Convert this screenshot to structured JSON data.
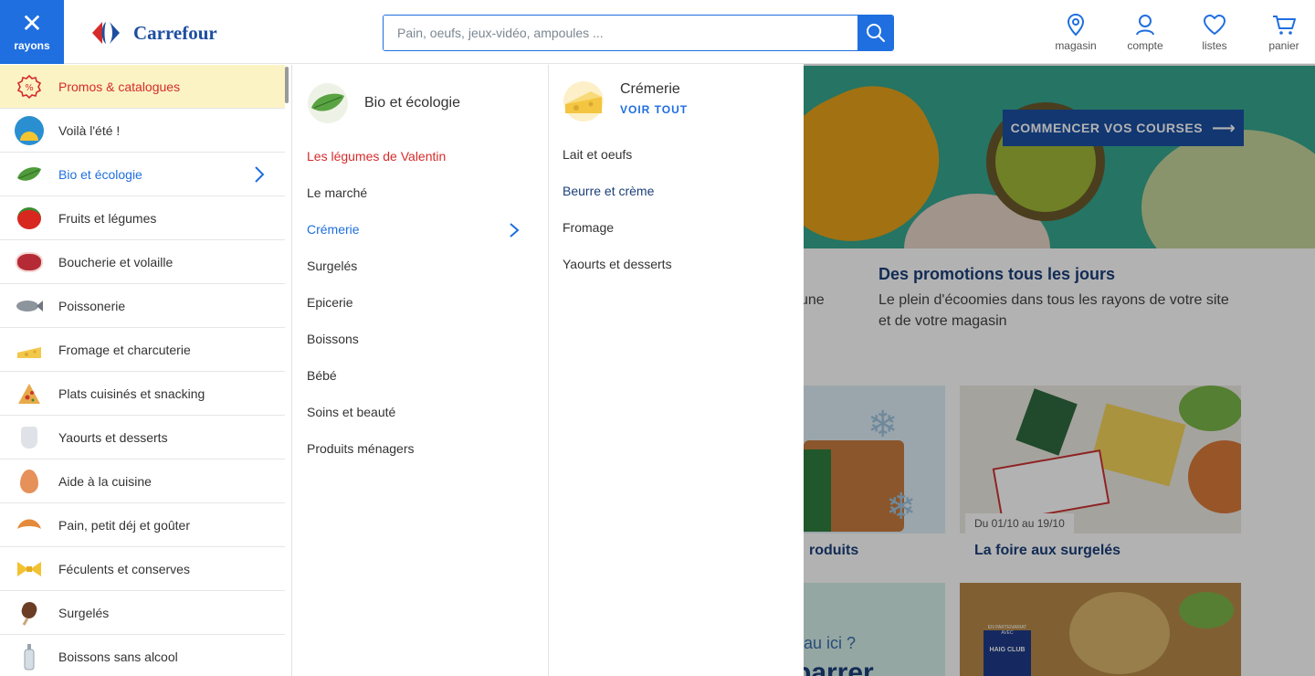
{
  "header": {
    "rayons_label": "rayons",
    "logo_text": "Carrefour",
    "search_placeholder": "Pain, oeufs, jeux-vidéo, ampoules ...",
    "icons": [
      {
        "label": "magasin",
        "icon": "location-pin-icon"
      },
      {
        "label": "compte",
        "icon": "user-icon"
      },
      {
        "label": "listes",
        "icon": "heart-icon"
      },
      {
        "label": "panier",
        "icon": "cart-icon"
      }
    ]
  },
  "colors": {
    "accent": "#1f6fe0",
    "promo_text": "#d62b2b",
    "promo_bg": "#fbf3c4",
    "navy": "#1a3f7a"
  },
  "menu_level1": [
    {
      "label": "Promos & catalogues",
      "icon": "percent-badge-icon"
    },
    {
      "label": "Voilà l'été !",
      "icon": "summer-icon"
    },
    {
      "label": "Bio et écologie",
      "icon": "leaf-icon"
    },
    {
      "label": "Fruits et légumes",
      "icon": "tomato-icon"
    },
    {
      "label": "Boucherie et volaille",
      "icon": "meat-icon"
    },
    {
      "label": "Poissonerie",
      "icon": "fish-icon"
    },
    {
      "label": "Fromage et charcuterie",
      "icon": "cheese-icon"
    },
    {
      "label": "Plats cuisinés et snacking",
      "icon": "pizza-icon"
    },
    {
      "label": "Yaourts et desserts",
      "icon": "yogurt-icon"
    },
    {
      "label": "Aide à la cuisine",
      "icon": "egg-icon"
    },
    {
      "label": "Pain, petit déj et goûter",
      "icon": "croissant-icon"
    },
    {
      "label": "Féculents et conserves",
      "icon": "pasta-icon"
    },
    {
      "label": "Surgelés",
      "icon": "ice-cream-icon"
    },
    {
      "label": "Boissons sans alcool",
      "icon": "bottle-icon"
    }
  ],
  "menu_level2": {
    "title": "Bio et écologie",
    "items": [
      {
        "label": "Les légumes de Valentin"
      },
      {
        "label": "Le marché"
      },
      {
        "label": "Crémerie"
      },
      {
        "label": "Surgelés"
      },
      {
        "label": "Epicerie"
      },
      {
        "label": "Boissons"
      },
      {
        "label": "Bébé"
      },
      {
        "label": "Soins et beauté"
      },
      {
        "label": "Produits ménagers"
      }
    ]
  },
  "menu_level3": {
    "title": "Crémerie",
    "see_all": "VOIR TOUT",
    "items": [
      {
        "label": "Lait et oeufs"
      },
      {
        "label": "Beurre et crème"
      },
      {
        "label": "Fromage"
      },
      {
        "label": "Yaourts et desserts"
      }
    ]
  },
  "background": {
    "cta_label": "COMMENCER VOS COURSES",
    "promo_title": "Des promotions tous les jours",
    "promo_text": "Le plein d'écoomies dans tous les rayons de votre site et de votre magasin",
    "partial_left_text": "une",
    "tile1_caption": "roduits",
    "tile2_date": "Du 01/10 au 19/10",
    "tile2_caption": "La foire aux surgelés",
    "tile3_text_a": "eau ici ?",
    "tile3_text_b": "parrer",
    "tile4_badge_top": "EN PARTENARIAT AVEC",
    "tile4_badge_brand": "HAIG CLUB"
  }
}
